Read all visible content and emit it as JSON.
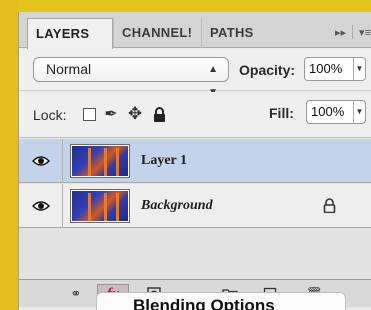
{
  "tabs": [
    {
      "label": "LAYERS",
      "active": true
    },
    {
      "label": "CHANNEL!",
      "active": false
    },
    {
      "label": "PATHS",
      "active": false
    }
  ],
  "tab_menu": {
    "collapse_label": "▸▸",
    "menu_label": "▾≡"
  },
  "blend": {
    "mode": "Normal",
    "opacity_label": "Opacity:",
    "opacity_value": "100%"
  },
  "lock": {
    "label": "Lock:",
    "fill_label": "Fill:",
    "fill_value": "100%"
  },
  "layers": [
    {
      "name": "Layer 1",
      "selected": true,
      "visible": true,
      "locked": false
    },
    {
      "name": "Background",
      "selected": false,
      "visible": true,
      "locked": true
    }
  ],
  "bottom_tools": [
    "link-layers-icon",
    "fx-icon",
    "mask-icon",
    "adjustment-icon",
    "group-icon",
    "new-layer-icon",
    "trash-icon"
  ],
  "fx_label": "fx",
  "tooltip": "Blending Options",
  "colors": {
    "accent_yellow": "#e6c21e",
    "selected_row": "#c3d3ea",
    "fx_red": "#b2124c"
  }
}
